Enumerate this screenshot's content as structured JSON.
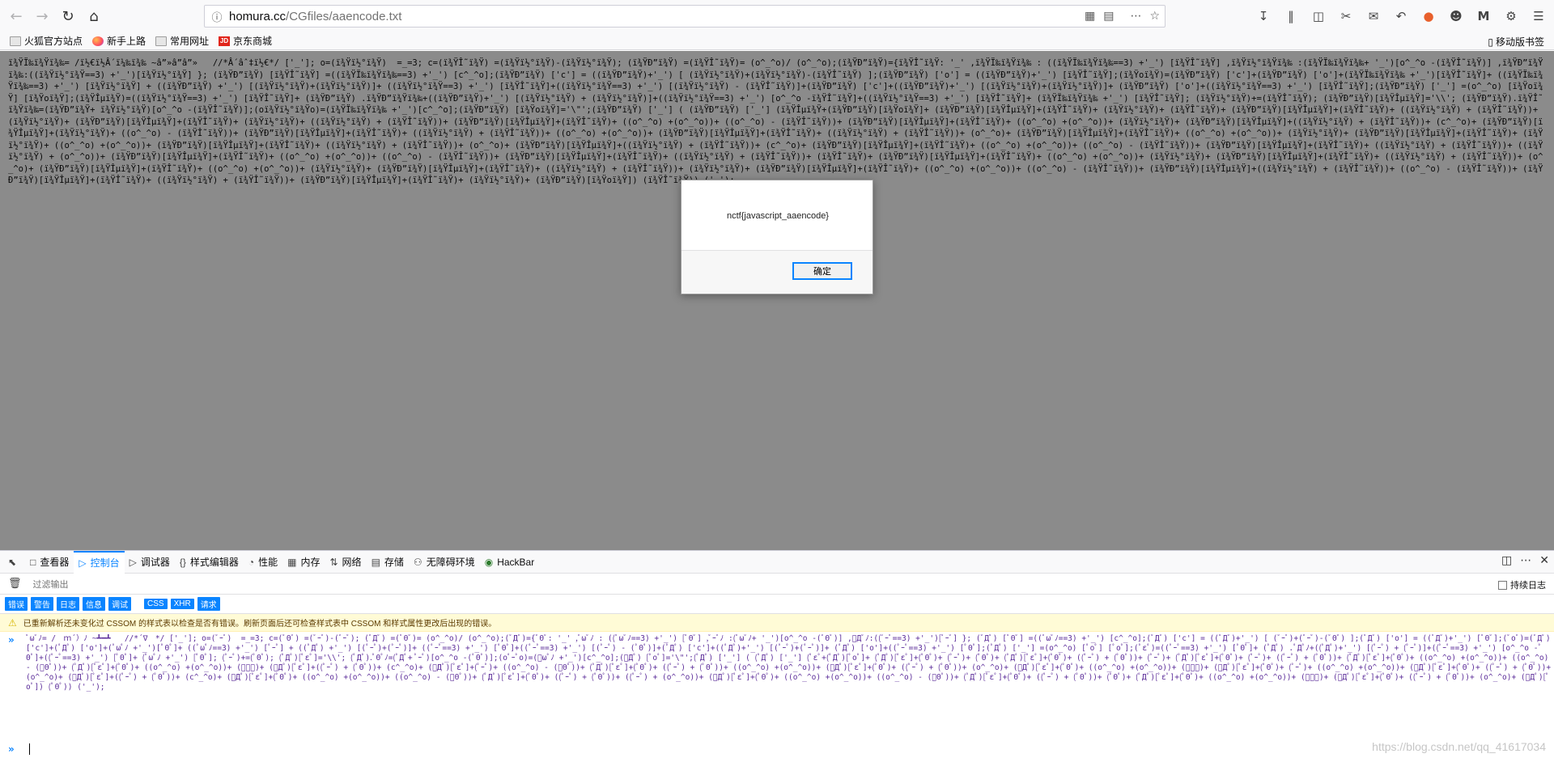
{
  "browser": {
    "url_host": "homura.cc",
    "url_path": "/CGfiles/aaencode.txt"
  },
  "bookmarks": {
    "items": [
      {
        "label": "火狐官方站点",
        "icon": "folder-icon"
      },
      {
        "label": "新手上路",
        "icon": "firefox-icon"
      },
      {
        "label": "常用网址",
        "icon": "folder-icon"
      },
      {
        "label": "京东商城",
        "icon": "jd-icon"
      }
    ],
    "mobile": "移动版书签"
  },
  "page": {
    "code": "ï¾ŸÏ‰ï¾Ÿï¾‰= /ï½€ï½Â´ï¼‰ï¾‰ ~â”»â”â”»   //*Â´âˆ‡ï½€*/ ['_']; o=(ï¾Ÿï½°ï¾Ÿ)  =_=3; c=(ï¾ŸÎ˜ï¾Ÿ) =(ï¾Ÿï½°ï¾Ÿ)-(ï¾Ÿï½°ï¾Ÿ); (ï¾ŸÐ”ï¾Ÿ) =(ï¾ŸÎ˜ï¾Ÿ)= (o^_^o)/ (o^_^o);(ï¾ŸÐ”ï¾Ÿ)={ï¾ŸÎ˜ï¾Ÿ: '_' ,ï¾ŸÏ‰ï¾Ÿï¾‰ : ((ï¾ŸÏ‰ï¾Ÿï¾‰==3) +'_') [ï¾ŸÎ˜ï¾Ÿ] ,ï¾Ÿï½°ï¾Ÿï¾‰ :(ï¾ŸÏ‰ï¾Ÿï¾‰+ '_')[o^_^o -(ï¾ŸÎ˜ï¾Ÿ)] ,ï¾ŸÐ”ï¾Ÿï¾‰:((ï¾Ÿï½°ï¾Ÿ==3) +'_')[ï¾Ÿï½°ï¾Ÿ] }; (ï¾ŸÐ”ï¾Ÿ) [ï¾ŸÎ˜ï¾Ÿ] =((ï¾ŸÏ‰ï¾Ÿï¾‰==3) +'_') [c^_^o];(ï¾ŸÐ”ï¾Ÿ) ['c'] = ((ï¾ŸÐ”ï¾Ÿ)+'_') [ (ï¾Ÿï½°ï¾Ÿ)+(ï¾Ÿï½°ï¾Ÿ)-(ï¾ŸÎ˜ï¾Ÿ) ];(ï¾ŸÐ”ï¾Ÿ) ['o'] = ((ï¾ŸÐ”ï¾Ÿ)+'_') [ï¾ŸÎ˜ï¾Ÿ];(ï¾Ÿoï¾Ÿ)=(ï¾ŸÐ”ï¾Ÿ) ['c']+(ï¾ŸÐ”ï¾Ÿ) ['o']+(ï¾ŸÏ‰ï¾Ÿï¾‰ +'_')[ï¾ŸÎ˜ï¾Ÿ]+ ((ï¾ŸÏ‰ï¾Ÿï¾‰==3) +'_') [ï¾Ÿï½°ï¾Ÿ] + ((ï¾ŸÐ”ï¾Ÿ) +'_') [(ï¾Ÿï½°ï¾Ÿ)+(ï¾Ÿï½°ï¾Ÿ)]+ ((ï¾Ÿï½°ï¾Ÿ==3) +'_') [ï¾ŸÎ˜ï¾Ÿ]+((ï¾Ÿï½°ï¾Ÿ==3) +'_') [(ï¾Ÿï½°ï¾Ÿ) - (ï¾ŸÎ˜ï¾Ÿ)]+(ï¾ŸÐ”ï¾Ÿ) ['c']+((ï¾ŸÐ”ï¾Ÿ)+'_') [(ï¾Ÿï½°ï¾Ÿ)+(ï¾Ÿï½°ï¾Ÿ)]+ (ï¾ŸÐ”ï¾Ÿ) ['o']+((ï¾Ÿï½°ï¾Ÿ==3) +'_') [ï¾ŸÎ˜ï¾Ÿ];(ï¾ŸÐ”ï¾Ÿ) ['_'] =(o^_^o) [ï¾Ÿoï¾Ÿ] [ï¾Ÿoï¾Ÿ];(ï¾ŸÎµï¾Ÿ)=((ï¾Ÿï½°ï¾Ÿ==3) +'_') [ï¾ŸÎ˜ï¾Ÿ]+ (ï¾ŸÐ”ï¾Ÿ) .ï¾ŸÐ”ï¾Ÿï¾‰+((ï¾ŸÐ”ï¾Ÿ)+'_') [(ï¾Ÿï½°ï¾Ÿ) + (ï¾Ÿï½°ï¾Ÿ)]+((ï¾Ÿï½°ï¾Ÿ==3) +'_') [o^_^o -ï¾ŸÎ˜ï¾Ÿ]+((ï¾Ÿï½°ï¾Ÿ==3) +'_') [ï¾ŸÎ˜ï¾Ÿ]+ (ï¾ŸÏ‰ï¾Ÿï¾‰ +'_') [ï¾ŸÎ˜ï¾Ÿ]; (ï¾Ÿï½°ï¾Ÿ)+=(ï¾ŸÎ˜ï¾Ÿ); (ï¾ŸÐ”ï¾Ÿ)[ï¾ŸÎµï¾Ÿ]='\\\\'; (ï¾ŸÐ”ï¾Ÿ).ï¾ŸÎ˜ï¾Ÿï¾‰=(ï¾ŸÐ”ï¾Ÿ+ ï¾Ÿï½°ï¾Ÿ)[o^_^o -(ï¾ŸÎ˜ï¾Ÿ)];(oï¾Ÿï½°ï¾Ÿo)=(ï¾ŸÏ‰ï¾Ÿï¾‰ +'_')[c^_^o];(ï¾ŸÐ”ï¾Ÿ) [ï¾Ÿoï¾Ÿ]='\\\"';(ï¾ŸÐ”ï¾Ÿ) ['_'] ( (ï¾ŸÐ”ï¾Ÿ) ['_'] (ï¾ŸÎµï¾Ÿ+(ï¾ŸÐ”ï¾Ÿ)[ï¾Ÿoï¾Ÿ]+ (ï¾ŸÐ”ï¾Ÿ)[ï¾ŸÎµï¾Ÿ]+(ï¾ŸÎ˜ï¾Ÿ)+ (ï¾Ÿï½°ï¾Ÿ)+ (ï¾ŸÎ˜ï¾Ÿ)+ (ï¾ŸÐ”ï¾Ÿ)[ï¾ŸÎµï¾Ÿ]+(ï¾ŸÎ˜ï¾Ÿ)+ ((ï¾Ÿï½°ï¾Ÿ) + (ï¾ŸÎ˜ï¾Ÿ))+ (ï¾Ÿï½°ï¾Ÿ)+ (ï¾ŸÐ”ï¾Ÿ)[ï¾ŸÎµï¾Ÿ]+(ï¾ŸÎ˜ï¾Ÿ)+ (ï¾Ÿï½°ï¾Ÿ)+ ((ï¾Ÿï½°ï¾Ÿ) + (ï¾ŸÎ˜ï¾Ÿ))+ (ï¾ŸÐ”ï¾Ÿ)[ï¾ŸÎµï¾Ÿ]+(ï¾ŸÎ˜ï¾Ÿ)+ ((o^_^o) +(o^_^o))+ ((o^_^o) - (ï¾ŸÎ˜ï¾Ÿ))+ (ï¾ŸÐ”ï¾Ÿ)[ï¾ŸÎµï¾Ÿ]+(ï¾ŸÎ˜ï¾Ÿ)+ ((o^_^o) +(o^_^o))+ (ï¾Ÿï½°ï¾Ÿ)+ (ï¾ŸÐ”ï¾Ÿ)[ï¾ŸÎµï¾Ÿ]+((ï¾Ÿï½°ï¾Ÿ) + (ï¾ŸÎ˜ï¾Ÿ))+ (c^_^o)+ (ï¾ŸÐ”ï¾Ÿ)[ï¾ŸÎµï¾Ÿ]+(ï¾Ÿï½°ï¾Ÿ)+ ((o^_^o) - (ï¾ŸÎ˜ï¾Ÿ))+ (ï¾ŸÐ”ï¾Ÿ)[ï¾ŸÎµï¾Ÿ]+(ï¾ŸÎ˜ï¾Ÿ)+ ((ï¾Ÿï½°ï¾Ÿ) + (ï¾ŸÎ˜ï¾Ÿ))+ ((o^_^o) +(o^_^o))+ (ï¾ŸÐ”ï¾Ÿ)[ï¾ŸÎµï¾Ÿ]+(ï¾ŸÎ˜ï¾Ÿ)+ ((ï¾Ÿï½°ï¾Ÿ) + (ï¾ŸÎ˜ï¾Ÿ))+ (o^_^o)+ (ï¾ŸÐ”ï¾Ÿ)[ï¾ŸÎµï¾Ÿ]+(ï¾ŸÎ˜ï¾Ÿ)+ ((o^_^o) +(o^_^o))+ (ï¾Ÿï½°ï¾Ÿ)+ (ï¾ŸÐ”ï¾Ÿ)[ï¾ŸÎµï¾Ÿ]+(ï¾ŸÎ˜ï¾Ÿ)+ (ï¾Ÿï½°ï¾Ÿ)+ ((o^_^o) +(o^_^o))+ (ï¾ŸÐ”ï¾Ÿ)[ï¾ŸÎµï¾Ÿ]+(ï¾ŸÎ˜ï¾Ÿ)+ ((ï¾Ÿï½°ï¾Ÿ) + (ï¾ŸÎ˜ï¾Ÿ))+ (o^_^o)+ (ï¾ŸÐ”ï¾Ÿ)[ï¾ŸÎµï¾Ÿ]+((ï¾Ÿï½°ï¾Ÿ) + (ï¾ŸÎ˜ï¾Ÿ))+ (c^_^o)+ (ï¾ŸÐ”ï¾Ÿ)[ï¾ŸÎµï¾Ÿ]+(ï¾ŸÎ˜ï¾Ÿ)+ ((o^_^o) +(o^_^o))+ ((o^_^o) - (ï¾ŸÎ˜ï¾Ÿ))+ (ï¾ŸÐ”ï¾Ÿ)[ï¾ŸÎµï¾Ÿ]+(ï¾ŸÎ˜ï¾Ÿ)+ ((ï¾Ÿï½°ï¾Ÿ) + (ï¾ŸÎ˜ï¾Ÿ))+ ((ï¾Ÿï½°ï¾Ÿ) + (o^_^o))+ (ï¾ŸÐ”ï¾Ÿ)[ï¾ŸÎµï¾Ÿ]+(ï¾ŸÎ˜ï¾Ÿ)+ ((o^_^o) +(o^_^o))+ ((o^_^o) - (ï¾ŸÎ˜ï¾Ÿ))+ (ï¾ŸÐ”ï¾Ÿ)[ï¾ŸÎµï¾Ÿ]+(ï¾ŸÎ˜ï¾Ÿ)+ ((ï¾Ÿï½°ï¾Ÿ) + (ï¾ŸÎ˜ï¾Ÿ))+ (ï¾ŸÎ˜ï¾Ÿ)+ (ï¾ŸÐ”ï¾Ÿ)[ï¾ŸÎµï¾Ÿ]+(ï¾ŸÎ˜ï¾Ÿ)+ ((o^_^o) +(o^_^o))+ (ï¾Ÿï½°ï¾Ÿ)+ (ï¾ŸÐ”ï¾Ÿ)[ï¾ŸÎµï¾Ÿ]+(ï¾ŸÎ˜ï¾Ÿ)+ ((ï¾Ÿï½°ï¾Ÿ) + (ï¾ŸÎ˜ï¾Ÿ))+ (o^_^o)+ (ï¾ŸÐ”ï¾Ÿ)[ï¾ŸÎµï¾Ÿ]+(ï¾ŸÎ˜ï¾Ÿ)+ ((o^_^o) +(o^_^o))+ (ï¾Ÿï½°ï¾Ÿ)+ (ï¾ŸÐ”ï¾Ÿ)[ï¾ŸÎµï¾Ÿ]+(ï¾ŸÎ˜ï¾Ÿ)+ ((ï¾Ÿï½°ï¾Ÿ) + (ï¾ŸÎ˜ï¾Ÿ))+ (ï¾Ÿï½°ï¾Ÿ)+ (ï¾ŸÐ”ï¾Ÿ)[ï¾ŸÎµï¾Ÿ]+(ï¾ŸÎ˜ï¾Ÿ)+ ((o^_^o) +(o^_^o))+ ((o^_^o) - (ï¾ŸÎ˜ï¾Ÿ))+ (ï¾ŸÐ”ï¾Ÿ)[ï¾ŸÎµï¾Ÿ]+((ï¾Ÿï½°ï¾Ÿ) + (ï¾ŸÎ˜ï¾Ÿ))+ ((o^_^o) - (ï¾ŸÎ˜ï¾Ÿ))+ (ï¾ŸÐ”ï¾Ÿ)[ï¾ŸÎµï¾Ÿ]+(ï¾ŸÎ˜ï¾Ÿ)+ ((ï¾Ÿï½°ï¾Ÿ) + (ï¾ŸÎ˜ï¾Ÿ))+ (ï¾ŸÐ”ï¾Ÿ)[ï¾ŸÎµï¾Ÿ]+(ï¾ŸÎ˜ï¾Ÿ)+ (ï¾Ÿï½°ï¾Ÿ)+ (ï¾ŸÐ”ï¾Ÿ)[ï¾Ÿoï¾Ÿ]) (ï¾ŸÎ˜ï¾Ÿ)) ('_');"
  },
  "dialog": {
    "message": "nctf{javascript_aaencode}",
    "ok": "确定"
  },
  "devtools": {
    "tabs": [
      {
        "label": "查看器",
        "icon": "inspector-icon"
      },
      {
        "label": "控制台",
        "icon": "console-icon"
      },
      {
        "label": "调试器",
        "icon": "debugger-icon"
      },
      {
        "label": "样式编辑器",
        "icon": "style-editor-icon"
      },
      {
        "label": "性能",
        "icon": "performance-icon"
      },
      {
        "label": "内存",
        "icon": "memory-icon"
      },
      {
        "label": "网络",
        "icon": "network-icon"
      },
      {
        "label": "存储",
        "icon": "storage-icon"
      },
      {
        "label": "无障碍环境",
        "icon": "accessibility-icon"
      },
      {
        "label": "HackBar",
        "icon": "hackbar-icon"
      }
    ],
    "filter_placeholder": "过滤输出",
    "persist_logs": "持续日志",
    "levels": [
      "错误",
      "警告",
      "日志",
      "信息",
      "调试"
    ],
    "levels2": [
      "CSS",
      "XHR",
      "请求"
    ],
    "warning": "已重新解析还未变化过 CSSOM 的样式表以检查是否有错误。刷新页面后还可检查样式表中 CSSOM 和样式属性更改后出现的错误。",
    "console_input": "ﾟωﾟﾉ= /｀ｍ´）ﾉ ~┻━┻   //*´∇｀*/ ['_']; o=(ﾟｰﾟ)  =_=3; c=(ﾟΘﾟ) =(ﾟｰﾟ)-(ﾟｰﾟ); (ﾟДﾟ) =(ﾟΘﾟ)= (o^_^o)/ (o^_^o);(ﾟДﾟ)={ﾟΘﾟ: '_' ,ﾟωﾟﾉ : ((ﾟωﾟﾉ==3) +'_') [ﾟΘﾟ] ,ﾟｰﾟﾉ :(ﾟωﾟﾉ+ '_')[o^_^o -(ﾟΘﾟ)] ,ﾟДﾟﾉ:((ﾟｰﾟ==3) +'_')[ﾟｰﾟ] }; (ﾟДﾟ) [ﾟΘﾟ] =((ﾟωﾟﾉ==3) +'_') [c^_^o];(ﾟДﾟ) ['c'] = ((ﾟДﾟ)+'_') [ (ﾟｰﾟ)+(ﾟｰﾟ)-(ﾟΘﾟ) ];(ﾟДﾟ) ['o'] = ((ﾟДﾟ)+'_') [ﾟΘﾟ];(ﾟoﾟ)=(ﾟДﾟ) ['c']+(ﾟДﾟ) ['o']+(ﾟωﾟﾉ +'_')[ﾟΘﾟ]+ ((ﾟωﾟﾉ==3) +'_') [ﾟｰﾟ] + ((ﾟДﾟ) +'_') [(ﾟｰﾟ)+(ﾟｰﾟ)]+ ((ﾟｰﾟ==3) +'_') [ﾟΘﾟ]+((ﾟｰﾟ==3) +'_') [(ﾟｰﾟ) - (ﾟΘﾟ)]+(ﾟДﾟ) ['c']+((ﾟДﾟ)+'_') [(ﾟｰﾟ)+(ﾟｰﾟ)]+ (ﾟДﾟ) ['o']+((ﾟｰﾟ==3) +'_') [ﾟΘﾟ];(ﾟДﾟ) ['_'] =(o^_^o) [ﾟoﾟ] [ﾟoﾟ];(ﾟεﾟ)=((ﾟｰﾟ==3) +'_') [ﾟΘﾟ]+ (ﾟДﾟ) .ﾟДﾟﾉ+((ﾟДﾟ)+'_') [(ﾟｰﾟ) + (ﾟｰﾟ)]+((ﾟｰﾟ==3) +'_') [o^_^o -ﾟΘﾟ]+((ﾟｰﾟ==3) +'_') [ﾟΘﾟ]+ (ﾟωﾟﾉ +'_') [ﾟΘﾟ]; (ﾟｰﾟ)+=(ﾟΘﾟ); (ﾟДﾟ)[ﾟεﾟ]='\\\\'; (ﾟДﾟ).ﾟΘﾟﾉ=(ﾟДﾟ+ ﾟｰﾟ)[o^_^o -(ﾟΘﾟ)];(oﾟｰﾟo)=(ﾟωﾟﾉ +'_')[c^_^o];(ﾟДﾟ) [ﾟoﾟ]='\\\"';(ﾟДﾟ) ['_'] ( (ﾟДﾟ) ['_'] (ﾟεﾟ+(ﾟДﾟ)[ﾟoﾟ]+ (ﾟДﾟ)[ﾟεﾟ]+(ﾟΘﾟ)+ (ﾟｰﾟ)+ (ﾟΘﾟ)+ (ﾟДﾟ)[ﾟεﾟ]+(ﾟΘﾟ)+ ((ﾟｰﾟ) + (ﾟΘﾟ))+ (ﾟｰﾟ)+ (ﾟДﾟ)[ﾟεﾟ]+(ﾟΘﾟ)+ (ﾟｰﾟ)+ ((ﾟｰﾟ) + (ﾟΘﾟ))+ (ﾟДﾟ)[ﾟεﾟ]+(ﾟΘﾟ)+ ((o^_^o) +(o^_^o))+ ((o^_^o) - (ﾟΘﾟ))+ (ﾟДﾟ)[ﾟεﾟ]+(ﾟΘﾟ)+ ((o^_^o) +(o^_^o))+ (ﾟｰﾟ)+ (ﾟДﾟ)[ﾟεﾟ]+((ﾟｰﾟ) + (ﾟΘﾟ))+ (c^_^o)+ (ﾟДﾟ)[ﾟεﾟ]+(ﾟｰﾟ)+ ((o^_^o) - (ﾟΘﾟ))+ (ﾟДﾟ)[ﾟεﾟ]+(ﾟΘﾟ)+ ((ﾟｰﾟ) + (ﾟΘﾟ))+ ((o^_^o) +(o^_^o))+ (ﾟДﾟ)[ﾟεﾟ]+(ﾟΘﾟ)+ ((ﾟｰﾟ) + (ﾟΘﾟ))+ (o^_^o)+ (ﾟДﾟ)[ﾟεﾟ]+(ﾟΘﾟ)+ ((o^_^o) +(o^_^o))+ (ﾟｰﾟ)+ (ﾟДﾟ)[ﾟεﾟ]+(ﾟΘﾟ)+ (ﾟｰﾟ)+ ((o^_^o) +(o^_^o))+ (ﾟДﾟ)[ﾟεﾟ]+(ﾟΘﾟ)+ ((ﾟｰﾟ) + (ﾟΘﾟ))+ (o^_^o)+ (ﾟДﾟ)[ﾟεﾟ]+((ﾟｰﾟ) + (ﾟΘﾟ))+ (c^_^o)+ (ﾟДﾟ)[ﾟεﾟ]+(ﾟΘﾟ)+ ((o^_^o) +(o^_^o))+ ((o^_^o) - (ﾟΘﾟ))+ (ﾟДﾟ)[ﾟεﾟ]+(ﾟΘﾟ)+ ((ﾟｰﾟ) + (ﾟΘﾟ))+ ((ﾟｰﾟ) + (o^_^o))+ (ﾟДﾟ)[ﾟεﾟ]+(ﾟΘﾟ)+ ((o^_^o) +(o^_^o))+ ((o^_^o) - (ﾟΘﾟ))+ (ﾟДﾟ)[ﾟεﾟ]+(ﾟΘﾟ)+ ((ﾟｰﾟ) + (ﾟΘﾟ))+ (ﾟΘﾟ)+ (ﾟДﾟ)[ﾟεﾟ]+(ﾟΘﾟ)+ ((o^_^o) +(o^_^o))+ (ﾟｰﾟ)+ (ﾟДﾟ)[ﾟεﾟ]+(ﾟΘﾟ)+ ((ﾟｰﾟ) + (ﾟΘﾟ))+ (o^_^o)+ (ﾟДﾟ)[ﾟoﾟ]) (ﾟΘﾟ)) ('_');",
    "watermark": "https://blog.csdn.net/qq_41617034"
  }
}
